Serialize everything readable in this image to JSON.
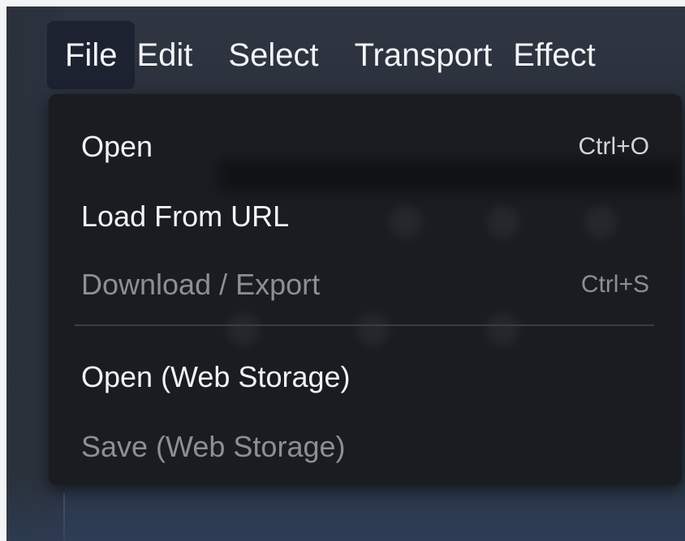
{
  "menubar": {
    "items": [
      {
        "label": "File"
      },
      {
        "label": "Edit"
      },
      {
        "label": "Select"
      },
      {
        "label": "Transport"
      },
      {
        "label": "Effect"
      }
    ]
  },
  "file_menu": {
    "items": [
      {
        "label": "Open",
        "shortcut": "Ctrl+O",
        "enabled": true
      },
      {
        "label": "Load From URL",
        "shortcut": "",
        "enabled": true
      },
      {
        "label": "Download / Export",
        "shortcut": "Ctrl+S",
        "enabled": false
      },
      {
        "label": "Open (Web Storage)",
        "shortcut": "",
        "enabled": true
      },
      {
        "label": "Save (Web Storage)",
        "shortcut": "",
        "enabled": false
      }
    ]
  }
}
